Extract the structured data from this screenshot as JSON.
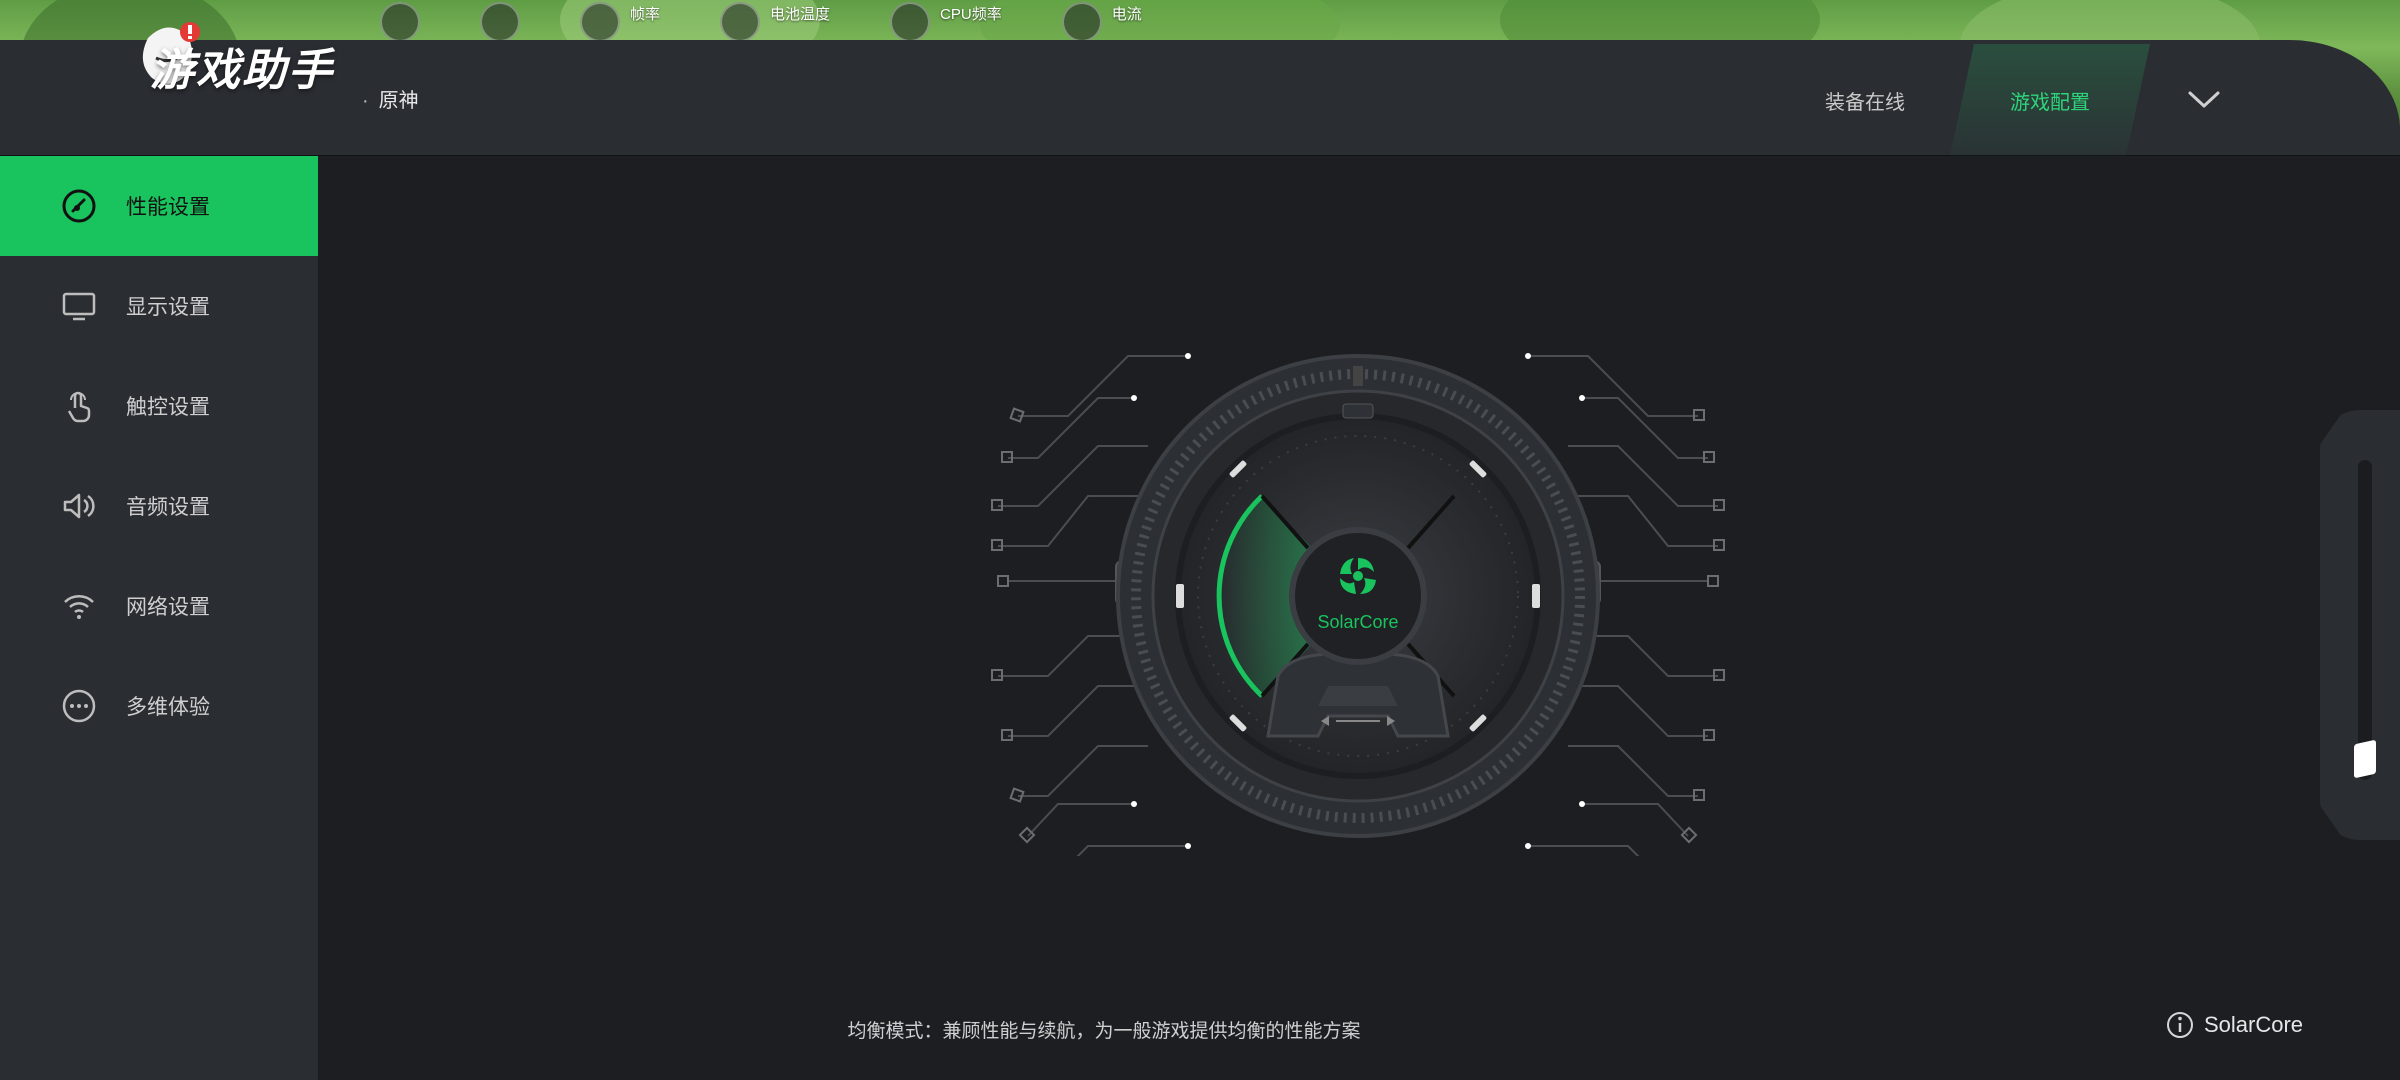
{
  "header": {
    "app_title": "游戏助手",
    "game_name": "原神",
    "game_dot": "·",
    "tabs": [
      {
        "label": "装备在线",
        "active": false
      },
      {
        "label": "游戏配置",
        "active": true
      }
    ]
  },
  "hud": {
    "items": [
      {
        "label": "帧率"
      },
      {
        "label": "电池温度"
      },
      {
        "label": "CPU频率"
      },
      {
        "label": "电流"
      }
    ]
  },
  "sidebar": {
    "items": [
      {
        "label": "性能设置",
        "icon": "speedometer-icon",
        "active": true
      },
      {
        "label": "显示设置",
        "icon": "monitor-icon",
        "active": false
      },
      {
        "label": "触控设置",
        "icon": "touch-icon",
        "active": false
      },
      {
        "label": "音频设置",
        "icon": "speaker-icon",
        "active": false
      },
      {
        "label": "网络设置",
        "icon": "wifi-icon",
        "active": false
      },
      {
        "label": "多维体验",
        "icon": "more-icon",
        "active": false
      }
    ]
  },
  "dial": {
    "brand": "SolarCore",
    "progress": 0.25
  },
  "main": {
    "mode_description": "均衡模式：兼顾性能与续航，为一般游戏提供均衡的性能方案",
    "brand_info": "SolarCore"
  },
  "colors": {
    "accent": "#19c35d",
    "accent_text": "#2fd47a",
    "panel": "#1c1e21",
    "sidebar": "#2a2d32"
  }
}
